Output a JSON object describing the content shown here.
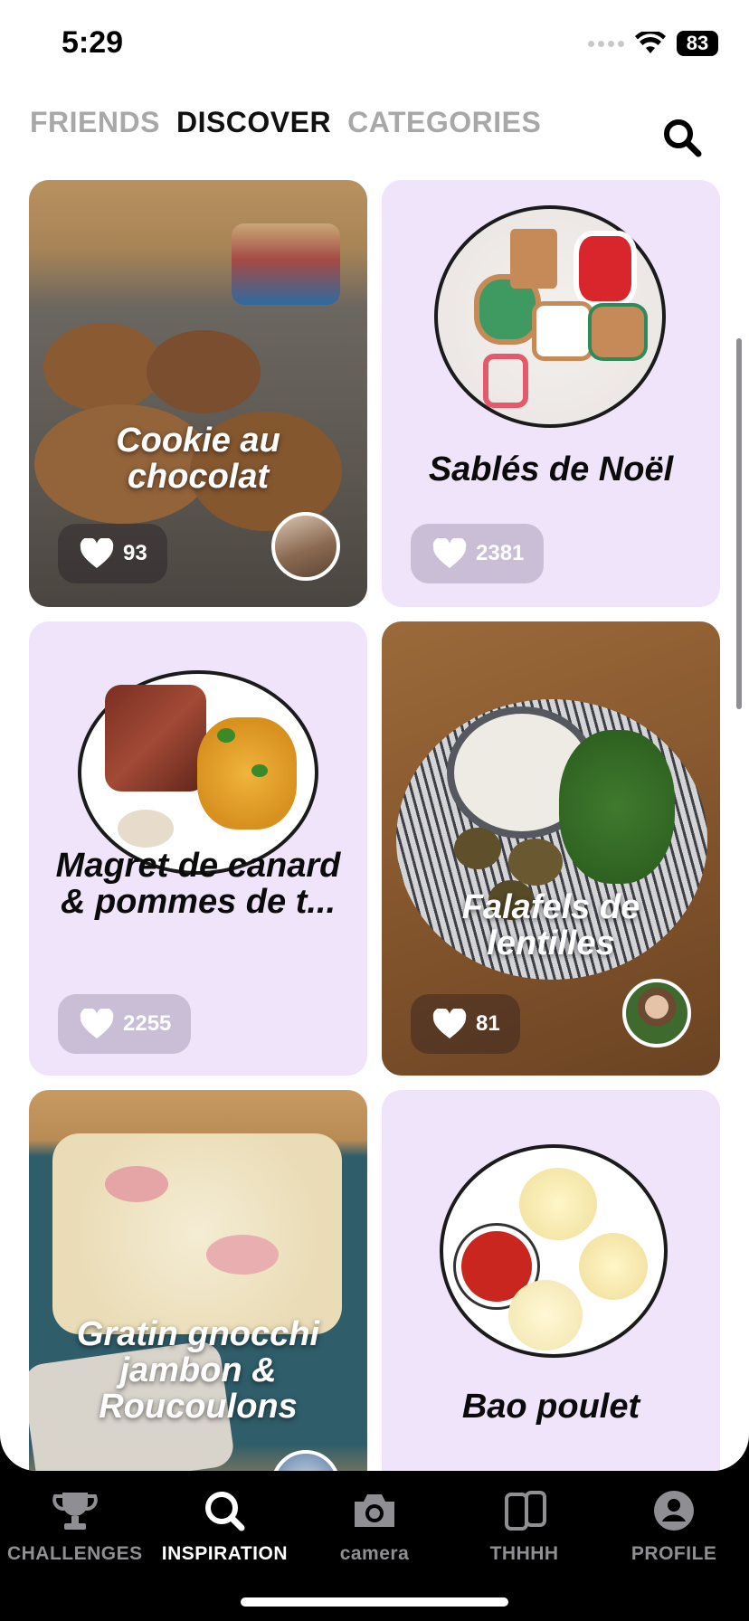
{
  "status": {
    "time": "5:29",
    "battery": "83"
  },
  "tabs": [
    {
      "label": "FRIENDS"
    },
    {
      "label": "DISCOVER"
    },
    {
      "label": "CATEGORIES"
    }
  ],
  "cards": [
    {
      "title": "Cookie au chocolat",
      "likes": "93"
    },
    {
      "title": "Sablés de Noël",
      "likes": "2381"
    },
    {
      "title": "Magret de canard & pommes de t...",
      "likes": "2255"
    },
    {
      "title": "Falafels de lentilles",
      "likes": "81"
    },
    {
      "title": "Gratin gnocchi jambon & Roucoulons",
      "likes": ""
    },
    {
      "title": "Bao poulet",
      "likes": ""
    }
  ],
  "nav": [
    {
      "label": "CHALLENGES",
      "icon": "trophy-icon"
    },
    {
      "label": "INSPIRATION",
      "icon": "search-icon"
    },
    {
      "label": "camera",
      "icon": "camera-icon"
    },
    {
      "label": "THHHH",
      "icon": "phone-stack-icon"
    },
    {
      "label": "PROFILE",
      "icon": "profile-icon"
    }
  ],
  "colors": {
    "card_bg": "#efe4f9",
    "active_tab": "#111111",
    "inactive_tab": "#a8a8a8"
  }
}
